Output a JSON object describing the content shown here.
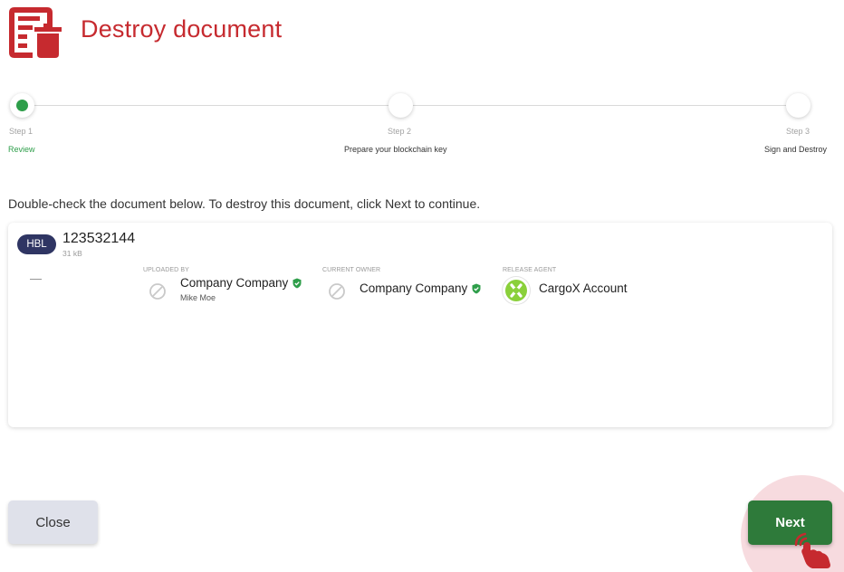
{
  "header": {
    "title": "Destroy document",
    "icon": "document-trash-icon",
    "accent_color": "#c62a2f"
  },
  "stepper": {
    "steps": [
      {
        "number": "Step 1",
        "label": "Review",
        "active": true
      },
      {
        "number": "Step 2",
        "label": "Prepare your blockchain key",
        "active": false
      },
      {
        "number": "Step 3",
        "label": "Sign and Destroy",
        "active": false
      }
    ],
    "active_color": "#2e9e4a"
  },
  "instruction": "Double-check the document below. To destroy this document, click Next to continue.",
  "document": {
    "type_badge": "HBL",
    "id": "123532144",
    "size": "31 kB",
    "placeholder": "—",
    "uploaded_by": {
      "caption": "UPLOADED BY",
      "name": "Company Company",
      "user": "Mike Moe",
      "verified": true,
      "icon": "no-avatar-icon"
    },
    "current_owner": {
      "caption": "CURRENT OWNER",
      "name": "Company Company",
      "verified": true,
      "icon": "no-avatar-icon"
    },
    "release_agent": {
      "caption": "RELEASE AGENT",
      "name": "CargoX Account",
      "icon": "cargox-logo-icon"
    }
  },
  "actions": {
    "close_label": "Close",
    "next_label": "Next",
    "next_color": "#2e7a3a"
  }
}
